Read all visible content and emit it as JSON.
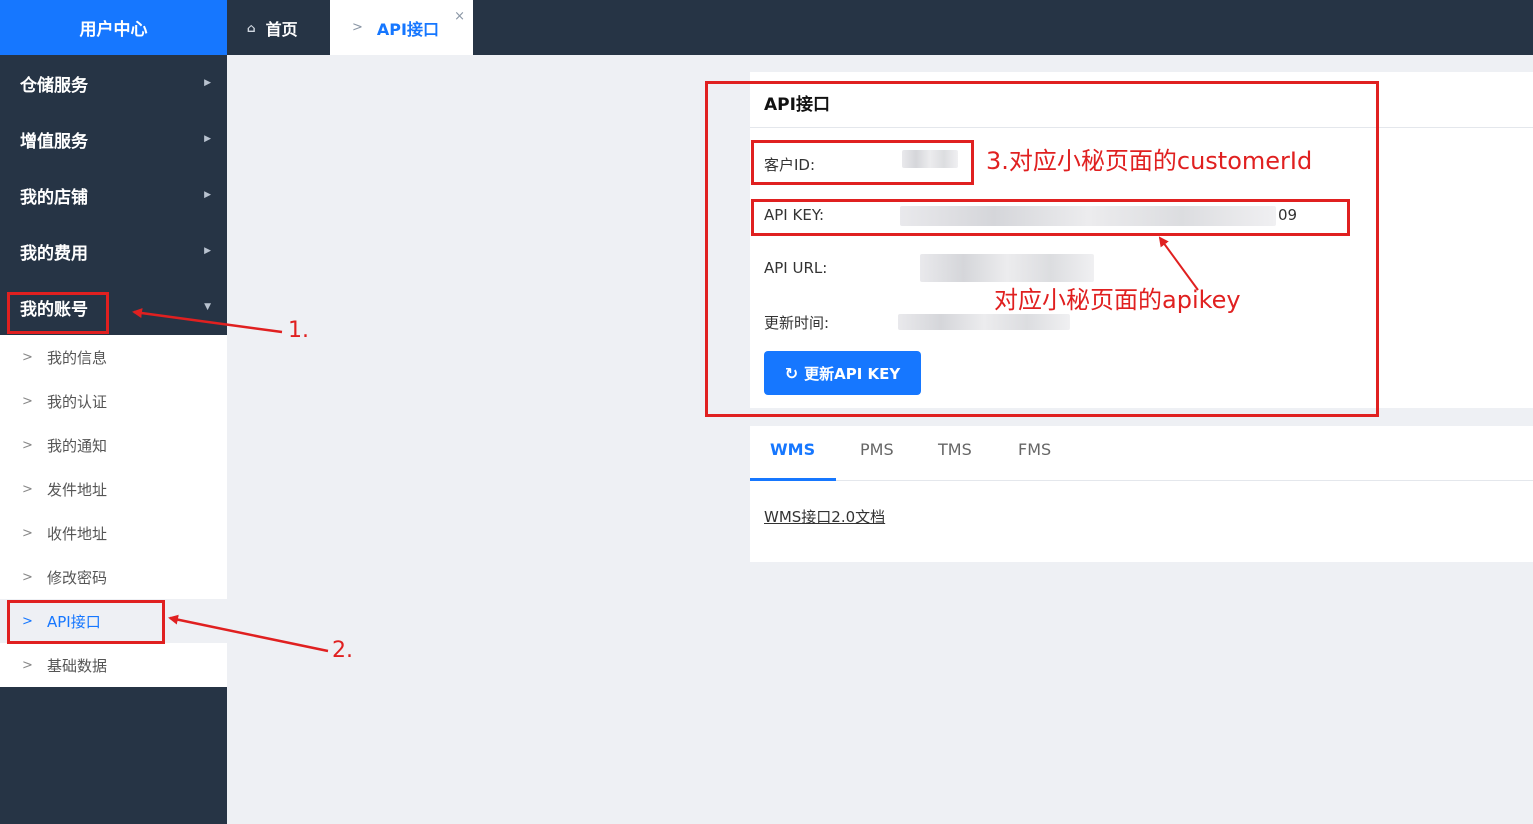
{
  "sidebar": {
    "brand": "用户中心",
    "menu": [
      {
        "label": "仓储服务",
        "expanded": false
      },
      {
        "label": "增值服务",
        "expanded": false
      },
      {
        "label": "我的店铺",
        "expanded": false
      },
      {
        "label": "我的费用",
        "expanded": false
      },
      {
        "label": "我的账号",
        "expanded": true
      }
    ],
    "submenu": [
      {
        "label": "我的信息"
      },
      {
        "label": "我的认证"
      },
      {
        "label": "我的通知"
      },
      {
        "label": "发件地址"
      },
      {
        "label": "收件地址"
      },
      {
        "label": "修改密码"
      },
      {
        "label": "API接口",
        "active": true
      },
      {
        "label": "基础数据"
      }
    ]
  },
  "topbar": {
    "tabs": [
      {
        "label": "首页",
        "icon": "home-icon"
      },
      {
        "label": "API接口",
        "active": true,
        "closable": true
      }
    ],
    "close_glyph": "×"
  },
  "card": {
    "title": "API接口",
    "fields": {
      "customer_id_label": "客户ID:",
      "api_key_label": "API KEY:",
      "api_key_visible_tail": "09",
      "api_url_label": "API URL:",
      "updated_label": "更新时间:"
    },
    "refresh_button": "更新API KEY"
  },
  "tabs_panel": {
    "tabs": [
      "WMS",
      "PMS",
      "TMS",
      "FMS"
    ],
    "active": "WMS",
    "doc_link": "WMS接口2.0文档"
  },
  "annotations": {
    "customer_id_note": "3.对应小秘页面的customerId",
    "apikey_note": "对应小秘页面的apikey",
    "step1": "1.",
    "step2": "2."
  },
  "colors": {
    "sidebar_bg": "#263445",
    "brand_blue": "#1677ff",
    "annotation_red": "#e02020"
  }
}
